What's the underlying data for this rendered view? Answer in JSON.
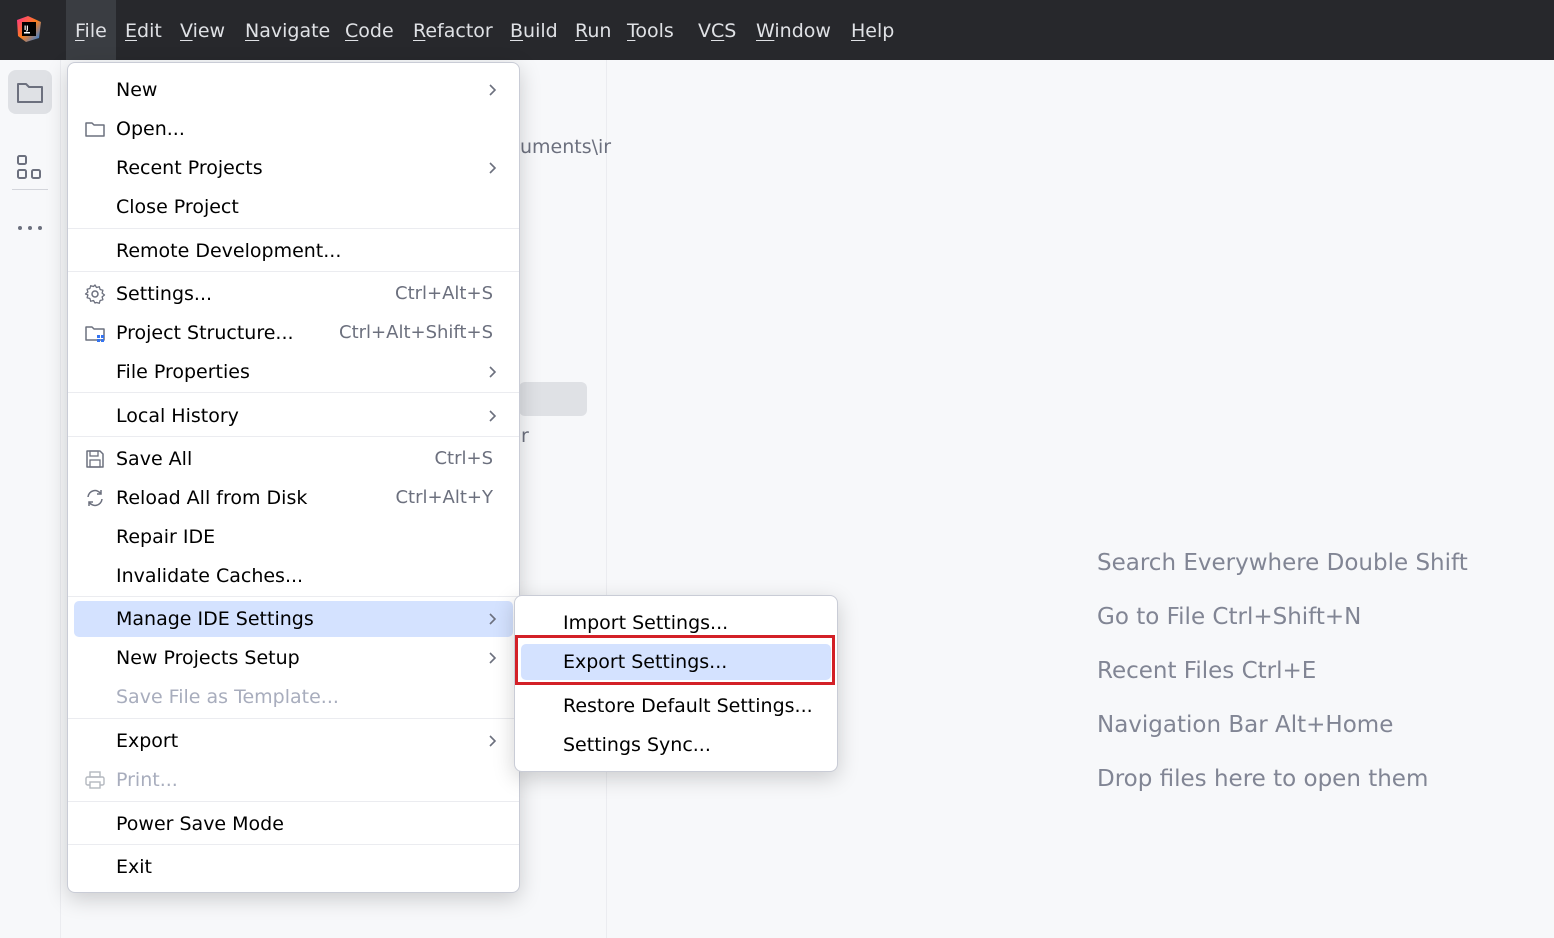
{
  "menubar": {
    "items": [
      {
        "label": "File",
        "mnemonic": "F",
        "rest": "ile"
      },
      {
        "label": "Edit",
        "mnemonic": "E",
        "rest": "dit"
      },
      {
        "label": "View",
        "mnemonic": "V",
        "rest": "iew"
      },
      {
        "label": "Navigate",
        "mnemonic": "N",
        "rest": "avigate"
      },
      {
        "label": "Code",
        "mnemonic": "C",
        "rest": "ode"
      },
      {
        "label": "Refactor",
        "mnemonic": "R",
        "rest": "efactor"
      },
      {
        "label": "Build",
        "mnemonic": "B",
        "rest": "uild"
      },
      {
        "label": "Run",
        "mnemonic": "R",
        "rest": "un"
      },
      {
        "label": "Tools",
        "mnemonic": "T",
        "rest": "ools"
      },
      {
        "label": "VCS",
        "mnemonic": "",
        "rest": "VCS"
      },
      {
        "label": "Window",
        "mnemonic": "W",
        "rest": "indow"
      },
      {
        "label": "Help",
        "mnemonic": "H",
        "rest": "elp"
      }
    ]
  },
  "toolstrip": {
    "icons": [
      "folder-icon",
      "structure-icon",
      "more-icon"
    ]
  },
  "background": {
    "fragment_path": "uments\\ir",
    "fragment_r": "r"
  },
  "hints": [
    "Search Everywhere Double Shift",
    "Go to File Ctrl+Shift+N",
    "Recent Files Ctrl+E",
    "Navigation Bar Alt+Home",
    "Drop files here to open them"
  ],
  "file_menu": {
    "items": {
      "new": {
        "label": "New"
      },
      "open": {
        "label": "Open..."
      },
      "recent": {
        "label": "Recent Projects"
      },
      "close": {
        "label": "Close Project"
      },
      "remote": {
        "label": "Remote Development..."
      },
      "settings": {
        "label": "Settings...",
        "shortcut": "Ctrl+Alt+S"
      },
      "structure": {
        "label": "Project Structure...",
        "shortcut": "Ctrl+Alt+Shift+S"
      },
      "file_props": {
        "label": "File Properties"
      },
      "local_history": {
        "label": "Local History"
      },
      "save_all": {
        "label": "Save All",
        "shortcut": "Ctrl+S"
      },
      "reload": {
        "label": "Reload All from Disk",
        "shortcut": "Ctrl+Alt+Y"
      },
      "repair": {
        "label": "Repair IDE"
      },
      "invalidate": {
        "label": "Invalidate Caches..."
      },
      "manage": {
        "label": "Manage IDE Settings"
      },
      "new_setup": {
        "label": "New Projects Setup"
      },
      "template": {
        "label": "Save File as Template..."
      },
      "export": {
        "label": "Export"
      },
      "print": {
        "label": "Print..."
      },
      "power": {
        "label": "Power Save Mode"
      },
      "exit": {
        "label": "Exit"
      }
    }
  },
  "submenu": {
    "import": "Import Settings...",
    "export": "Export Settings...",
    "restore": "Restore Default Settings...",
    "sync": "Settings Sync..."
  },
  "colors": {
    "menubar_bg": "#27282c",
    "selection": "#d4e2ff",
    "callout": "#d32027"
  }
}
